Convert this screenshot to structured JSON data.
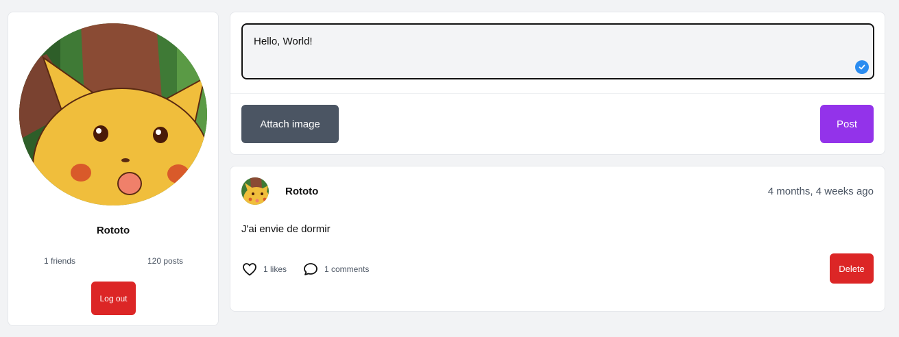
{
  "profile": {
    "avatar": "pikachu-surprised-avatar",
    "name": "Rototo",
    "friends": "1 friends",
    "posts": "120 posts",
    "logout_label": "Log out"
  },
  "composer": {
    "text": "Hello, World!",
    "attach_label": "Attach image",
    "post_label": "Post",
    "check_icon": "check-badge-icon"
  },
  "post": {
    "author": "Rototo",
    "time": "4 months, 4 weeks ago",
    "content": "J'ai envie de dormir",
    "likes": "1 likes",
    "comments": "1 comments",
    "delete_label": "Delete",
    "like_icon": "heart-icon",
    "comment_icon": "comment-bubble-icon"
  },
  "colors": {
    "logout": "#dc2626",
    "delete": "#dc2626",
    "post": "#9333ea",
    "attach": "#4b5563",
    "check": "#2b8cf0"
  }
}
